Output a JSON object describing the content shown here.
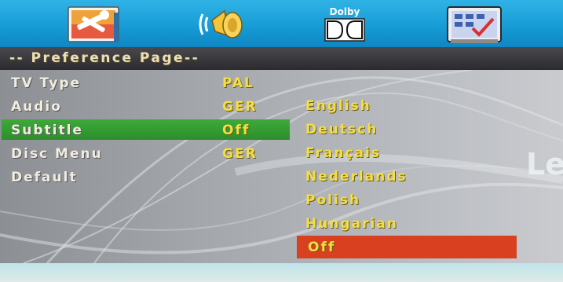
{
  "tabs": [
    {
      "name": "general-setup",
      "icon": "tools-icon"
    },
    {
      "name": "audio-setup",
      "icon": "speaker-icon"
    },
    {
      "name": "dolby-digital-setup",
      "icon": "dolby-icon",
      "label": "Dolby"
    },
    {
      "name": "preference-setup",
      "icon": "checklist-icon"
    }
  ],
  "page_title": "-- Preference Page--",
  "settings": [
    {
      "label": "TV Type",
      "value": "PAL"
    },
    {
      "label": "Audio",
      "value": "GER"
    },
    {
      "label": "Subtitle",
      "value": "Off",
      "selected": true
    },
    {
      "label": "Disc Menu",
      "value": "GER"
    },
    {
      "label": "Default",
      "value": ""
    }
  ],
  "subtitle_options": [
    "English",
    "Deutsch",
    "Français",
    "Nederlands",
    "Polish",
    "Hungarian",
    "Off"
  ],
  "selected_option": "Off",
  "background_text": "Le",
  "colors": {
    "topbar": "#169ad4",
    "titlebar": "#2b2b2f",
    "selected_row": "#2c8e2a",
    "selected_option": "#d9401f",
    "value_text": "#f4de45",
    "label_text": "#f1ece0"
  }
}
